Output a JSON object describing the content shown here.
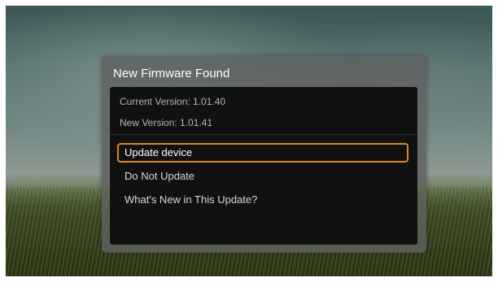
{
  "dialog": {
    "title": "New Firmware Found",
    "current_version": "Current Version: 1.01.40",
    "new_version": "New Version: 1.01.41",
    "menu": [
      {
        "label": "Update device",
        "selected": true
      },
      {
        "label": "Do Not Update",
        "selected": false
      },
      {
        "label": "What's New in This Update?",
        "selected": false
      }
    ]
  },
  "colors": {
    "selection_border": "#d8872a",
    "panel_background": "#111111",
    "dialog_background": "#5f6260"
  }
}
